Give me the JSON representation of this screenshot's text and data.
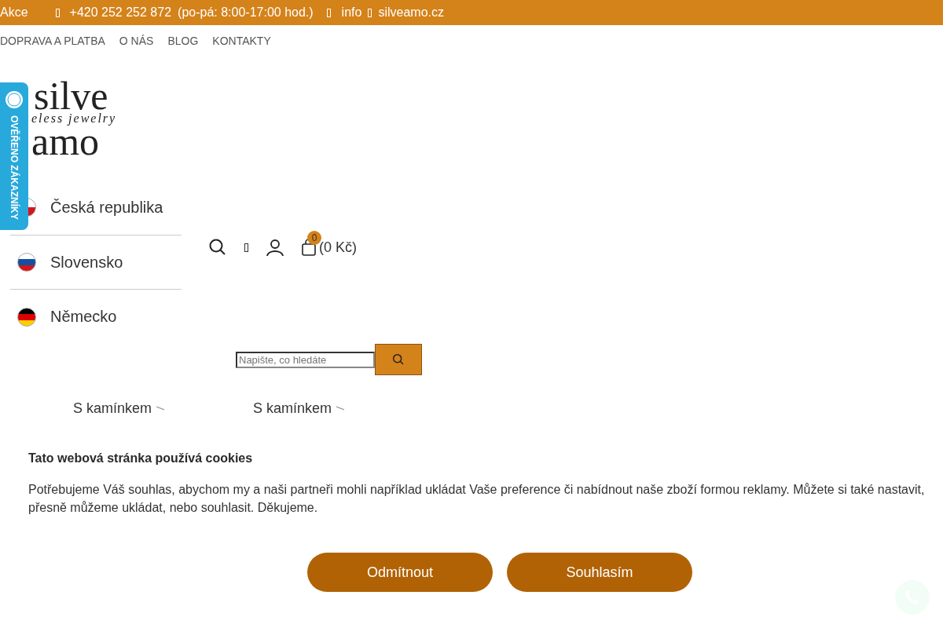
{
  "top_bar": {
    "promo": "Akce",
    "phone": "+420 252 252 872",
    "hours": "(po-pá: 8:00-17:00 hod.)",
    "email_user": "info",
    "email_domain": "silveamo.cz"
  },
  "nav": [
    "DOPRAVA A PLATBA",
    "O NÁS",
    "BLOG",
    "KONTAKTY"
  ],
  "logo": {
    "top": "silve",
    "tagline": "eless jewelry",
    "bottom": "amo"
  },
  "review_badge": {
    "label": "OVĚŘENO ZÁKAZNÍKY"
  },
  "countries": [
    {
      "name": "Česká republika",
      "kind": "cz"
    },
    {
      "name": "Slovensko",
      "kind": "sk"
    },
    {
      "name": "Německo",
      "kind": "de"
    }
  ],
  "cart": {
    "count": "0",
    "total": "(0 Kč)"
  },
  "search": {
    "placeholder": "Napište, co hledáte"
  },
  "menu_headings": [
    {
      "label": "S kamínkem",
      "submenu": true
    },
    {
      "label": "S kamínkem",
      "submenu": true
    }
  ],
  "cookie_banner": {
    "title": "Tato webová stránka používá cookies",
    "lines": [
      "Potřebujeme Váš souhlas, abychom my a naši partneři mohli například ukládat Vaše preference či nabídnout naše zboží formou reklamy. Můžete si také nastavit,",
      "přesně můžeme ukládat, nebo souhlasit. Děkujeme."
    ],
    "buttons": [
      "Odmítnout",
      "Souhlasím"
    ]
  }
}
